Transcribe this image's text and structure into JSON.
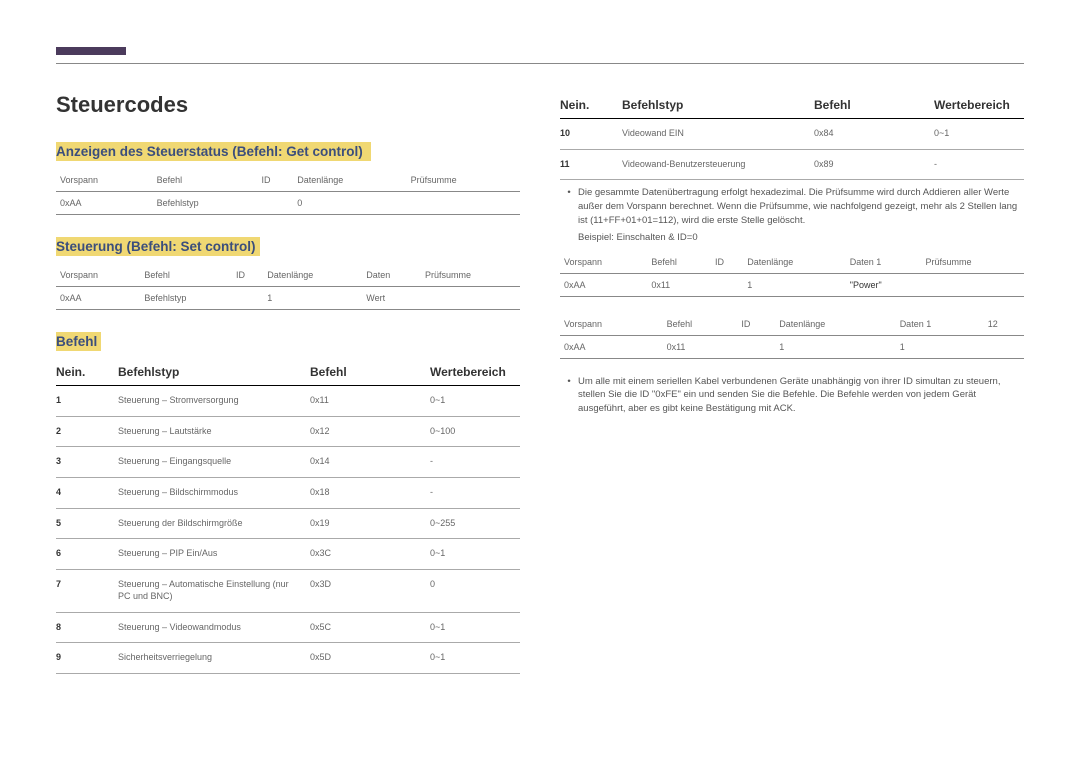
{
  "title": "Steuercodes",
  "section1": {
    "heading": "Anzeigen des Steuerstatus (Befehl: Get control)",
    "headers": [
      "Vorspann",
      "Befehl",
      "ID",
      "Datenlänge",
      "Prüfsumme"
    ],
    "row": [
      "0xAA",
      "Befehlstyp",
      "",
      "0",
      ""
    ]
  },
  "section2": {
    "heading": "Steuerung (Befehl: Set control)",
    "headers": [
      "Vorspann",
      "Befehl",
      "ID",
      "Datenlänge",
      "Daten",
      "Prüfsumme"
    ],
    "row": [
      "0xAA",
      "Befehlstyp",
      "",
      "1",
      "Wert",
      ""
    ]
  },
  "befehl": {
    "heading": "Befehl",
    "columns": {
      "no": "Nein.",
      "type": "Befehlstyp",
      "cmd": "Befehl",
      "range": "Wertebereich"
    },
    "rows_left": [
      {
        "no": "1",
        "type": "Steuerung – Stromversorgung",
        "cmd": "0x11",
        "range": "0~1"
      },
      {
        "no": "2",
        "type": "Steuerung – Lautstärke",
        "cmd": "0x12",
        "range": "0~100"
      },
      {
        "no": "3",
        "type": "Steuerung – Eingangsquelle",
        "cmd": "0x14",
        "range": "-"
      },
      {
        "no": "4",
        "type": "Steuerung – Bildschirmmodus",
        "cmd": "0x18",
        "range": "-"
      },
      {
        "no": "5",
        "type": "Steuerung der Bildschirmgröße",
        "cmd": "0x19",
        "range": "0~255"
      },
      {
        "no": "6",
        "type": "Steuerung – PIP Ein/Aus",
        "cmd": "0x3C",
        "range": "0~1"
      },
      {
        "no": "7",
        "type": "Steuerung – Automatische Einstellung (nur PC und BNC)",
        "cmd": "0x3D",
        "range": "0"
      },
      {
        "no": "8",
        "type": "Steuerung – Videowandmodus",
        "cmd": "0x5C",
        "range": "0~1"
      },
      {
        "no": "9",
        "type": "Sicherheitsverriegelung",
        "cmd": "0x5D",
        "range": "0~1"
      }
    ],
    "rows_right": [
      {
        "no": "10",
        "type": "Videowand EIN",
        "cmd": "0x84",
        "range": "0~1"
      },
      {
        "no": "11",
        "type": "Videowand-Benutzersteuerung",
        "cmd": "0x89",
        "range": "-"
      }
    ]
  },
  "note1": "Die gesammte Datenübertragung erfolgt hexadezimal. Die Prüfsumme wird durch Addieren aller Werte außer dem Vorspann berechnet. Wenn die Prüfsumme, wie nachfolgend gezeigt, mehr als 2 Stellen lang ist (11+FF+01+01=112), wird die erste Stelle gelöscht.",
  "example_label": "Beispiel: Einschalten & ID=0",
  "example1": {
    "headers": [
      "Vorspann",
      "Befehl",
      "ID",
      "Datenlänge",
      "Daten 1",
      "Prüfsumme"
    ],
    "row": [
      "0xAA",
      "0x11",
      "",
      "1",
      "\"Power\"",
      ""
    ]
  },
  "example2": {
    "headers": [
      "Vorspann",
      "Befehl",
      "ID",
      "Datenlänge",
      "Daten 1",
      "12"
    ],
    "row": [
      "0xAA",
      "0x11",
      "",
      "1",
      "1",
      ""
    ]
  },
  "note2": "Um alle mit einem seriellen Kabel verbundenen Geräte unabhängig von ihrer ID simultan zu steuern, stellen Sie die ID \"0xFE\" ein und senden Sie die Befehle. Die Befehle werden von jedem Gerät ausgeführt, aber es gibt keine Bestätigung mit ACK."
}
